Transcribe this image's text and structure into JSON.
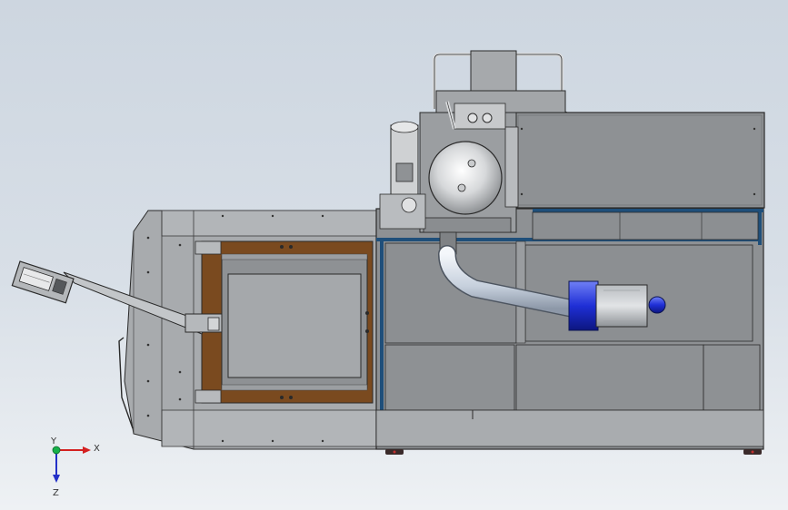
{
  "view": {
    "background_top": "#cdd6e0",
    "background_bottom": "#eef1f4"
  },
  "colors": {
    "frame": "#a9acaf",
    "panel": "#8e9194",
    "panel_dark": "#7e8184",
    "outline": "#2a2a2a",
    "rail_blue": "#1f4f7a",
    "wood": "#7a4a1f",
    "motor_blue": "#1f2fd6",
    "hose": "#c9d3e0"
  },
  "axis_triad": {
    "x_label": "X",
    "y_label": "Y",
    "z_label": "Z",
    "x_color": "#d42020",
    "y_color": "#17b04a",
    "z_color": "#2330c8"
  }
}
